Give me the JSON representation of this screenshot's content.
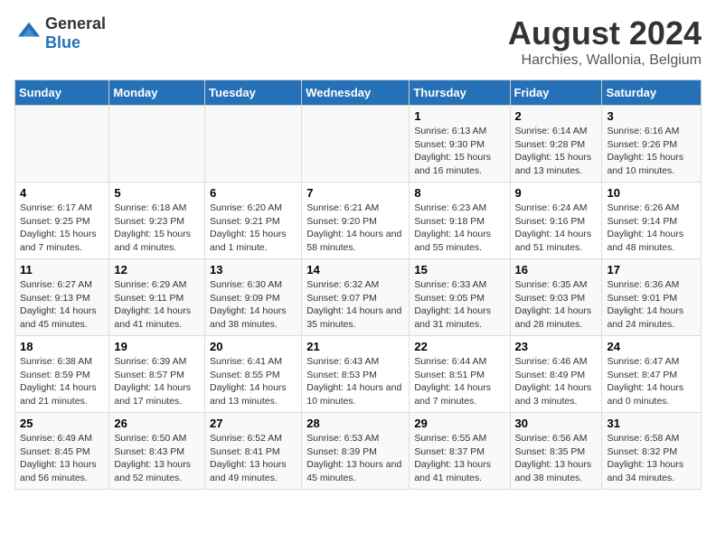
{
  "header": {
    "logo_line1": "General",
    "logo_line2": "Blue",
    "main_title": "August 2024",
    "sub_title": "Harchies, Wallonia, Belgium"
  },
  "days_of_week": [
    "Sunday",
    "Monday",
    "Tuesday",
    "Wednesday",
    "Thursday",
    "Friday",
    "Saturday"
  ],
  "weeks": [
    [
      {
        "day": "",
        "info": ""
      },
      {
        "day": "",
        "info": ""
      },
      {
        "day": "",
        "info": ""
      },
      {
        "day": "",
        "info": ""
      },
      {
        "day": "1",
        "info": "Sunrise: 6:13 AM\nSunset: 9:30 PM\nDaylight: 15 hours and 16 minutes."
      },
      {
        "day": "2",
        "info": "Sunrise: 6:14 AM\nSunset: 9:28 PM\nDaylight: 15 hours and 13 minutes."
      },
      {
        "day": "3",
        "info": "Sunrise: 6:16 AM\nSunset: 9:26 PM\nDaylight: 15 hours and 10 minutes."
      }
    ],
    [
      {
        "day": "4",
        "info": "Sunrise: 6:17 AM\nSunset: 9:25 PM\nDaylight: 15 hours and 7 minutes."
      },
      {
        "day": "5",
        "info": "Sunrise: 6:18 AM\nSunset: 9:23 PM\nDaylight: 15 hours and 4 minutes."
      },
      {
        "day": "6",
        "info": "Sunrise: 6:20 AM\nSunset: 9:21 PM\nDaylight: 15 hours and 1 minute."
      },
      {
        "day": "7",
        "info": "Sunrise: 6:21 AM\nSunset: 9:20 PM\nDaylight: 14 hours and 58 minutes."
      },
      {
        "day": "8",
        "info": "Sunrise: 6:23 AM\nSunset: 9:18 PM\nDaylight: 14 hours and 55 minutes."
      },
      {
        "day": "9",
        "info": "Sunrise: 6:24 AM\nSunset: 9:16 PM\nDaylight: 14 hours and 51 minutes."
      },
      {
        "day": "10",
        "info": "Sunrise: 6:26 AM\nSunset: 9:14 PM\nDaylight: 14 hours and 48 minutes."
      }
    ],
    [
      {
        "day": "11",
        "info": "Sunrise: 6:27 AM\nSunset: 9:13 PM\nDaylight: 14 hours and 45 minutes."
      },
      {
        "day": "12",
        "info": "Sunrise: 6:29 AM\nSunset: 9:11 PM\nDaylight: 14 hours and 41 minutes."
      },
      {
        "day": "13",
        "info": "Sunrise: 6:30 AM\nSunset: 9:09 PM\nDaylight: 14 hours and 38 minutes."
      },
      {
        "day": "14",
        "info": "Sunrise: 6:32 AM\nSunset: 9:07 PM\nDaylight: 14 hours and 35 minutes."
      },
      {
        "day": "15",
        "info": "Sunrise: 6:33 AM\nSunset: 9:05 PM\nDaylight: 14 hours and 31 minutes."
      },
      {
        "day": "16",
        "info": "Sunrise: 6:35 AM\nSunset: 9:03 PM\nDaylight: 14 hours and 28 minutes."
      },
      {
        "day": "17",
        "info": "Sunrise: 6:36 AM\nSunset: 9:01 PM\nDaylight: 14 hours and 24 minutes."
      }
    ],
    [
      {
        "day": "18",
        "info": "Sunrise: 6:38 AM\nSunset: 8:59 PM\nDaylight: 14 hours and 21 minutes."
      },
      {
        "day": "19",
        "info": "Sunrise: 6:39 AM\nSunset: 8:57 PM\nDaylight: 14 hours and 17 minutes."
      },
      {
        "day": "20",
        "info": "Sunrise: 6:41 AM\nSunset: 8:55 PM\nDaylight: 14 hours and 13 minutes."
      },
      {
        "day": "21",
        "info": "Sunrise: 6:43 AM\nSunset: 8:53 PM\nDaylight: 14 hours and 10 minutes."
      },
      {
        "day": "22",
        "info": "Sunrise: 6:44 AM\nSunset: 8:51 PM\nDaylight: 14 hours and 7 minutes."
      },
      {
        "day": "23",
        "info": "Sunrise: 6:46 AM\nSunset: 8:49 PM\nDaylight: 14 hours and 3 minutes."
      },
      {
        "day": "24",
        "info": "Sunrise: 6:47 AM\nSunset: 8:47 PM\nDaylight: 14 hours and 0 minutes."
      }
    ],
    [
      {
        "day": "25",
        "info": "Sunrise: 6:49 AM\nSunset: 8:45 PM\nDaylight: 13 hours and 56 minutes."
      },
      {
        "day": "26",
        "info": "Sunrise: 6:50 AM\nSunset: 8:43 PM\nDaylight: 13 hours and 52 minutes."
      },
      {
        "day": "27",
        "info": "Sunrise: 6:52 AM\nSunset: 8:41 PM\nDaylight: 13 hours and 49 minutes."
      },
      {
        "day": "28",
        "info": "Sunrise: 6:53 AM\nSunset: 8:39 PM\nDaylight: 13 hours and 45 minutes."
      },
      {
        "day": "29",
        "info": "Sunrise: 6:55 AM\nSunset: 8:37 PM\nDaylight: 13 hours and 41 minutes."
      },
      {
        "day": "30",
        "info": "Sunrise: 6:56 AM\nSunset: 8:35 PM\nDaylight: 13 hours and 38 minutes."
      },
      {
        "day": "31",
        "info": "Sunrise: 6:58 AM\nSunset: 8:32 PM\nDaylight: 13 hours and 34 minutes."
      }
    ]
  ]
}
